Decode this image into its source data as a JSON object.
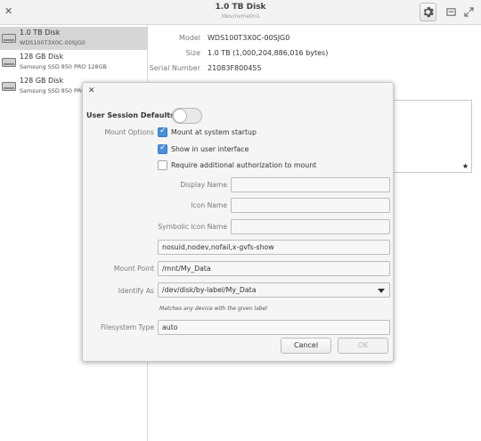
{
  "header": {
    "title": "1.0 TB Disk",
    "subtitle": "/dev/nvme0n1"
  },
  "sidebar": {
    "disks": [
      {
        "name": "1.0 TB Disk",
        "model": "WDS100T3X0C-00SJG0",
        "selected": true
      },
      {
        "name": "128 GB Disk",
        "model": "Samsung SSD 850 PRO 128GB",
        "selected": false
      },
      {
        "name": "128 GB Disk",
        "model": "Samsung SSD 850 PRO 128GB",
        "selected": false
      }
    ]
  },
  "details": {
    "model_label": "Model",
    "model_value": "WDS100T3X0C-00SJG0",
    "size_label": "Size",
    "size_value": "1.0 TB (1,000,204,886,016 bytes)",
    "serial_label": "Serial Number",
    "serial_value": "21083F800455"
  },
  "dialog": {
    "user_session_defaults_label": "User Session Defaults",
    "user_session_defaults_on": false,
    "mount_options_label": "Mount Options",
    "options": [
      {
        "label": "Mount at system startup",
        "checked": true
      },
      {
        "label": "Show in user interface",
        "checked": true
      },
      {
        "label": "Require additional authorization to mount",
        "checked": false
      }
    ],
    "display_name_label": "Display Name",
    "display_name_value": "",
    "icon_name_label": "Icon Name",
    "icon_name_value": "",
    "symbolic_icon_name_label": "Symbolic Icon Name",
    "symbolic_icon_name_value": "",
    "options_string": "nosuid,nodev,nofail,x-gvfs-show",
    "mount_point_label": "Mount Point",
    "mount_point_value": "/mnt/My_Data",
    "identify_as_label": "Identify As",
    "identify_as_value": "/dev/disk/by-label/My_Data",
    "identify_hint": "Matches any device with the given label",
    "filesystem_type_label": "Filesystem Type",
    "filesystem_type_value": "auto",
    "cancel_label": "Cancel",
    "ok_label": "OK"
  },
  "colors": {
    "accent": "#4a90d9",
    "selection": "#d6d6d6"
  }
}
